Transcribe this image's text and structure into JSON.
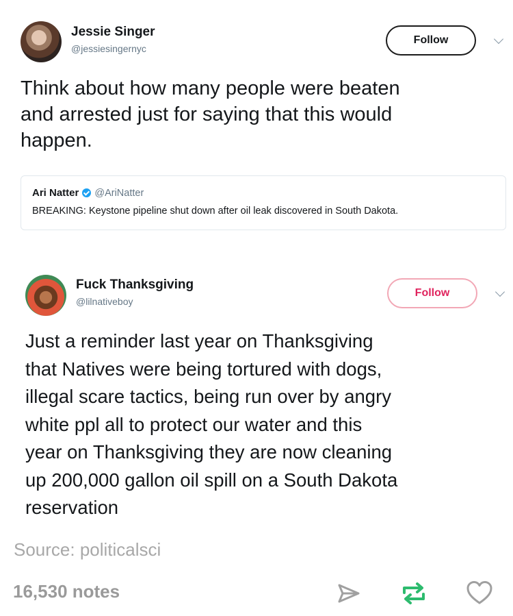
{
  "tweets": [
    {
      "user": {
        "name": "Jessie Singer",
        "handle": "@jessiesingernyc"
      },
      "follow_label": "Follow",
      "text_lines": [
        "Think about how many people were beaten",
        "and arrested just for saying that this would",
        "happen."
      ],
      "quote": {
        "name": "Ari Natter",
        "handle": "@AriNatter",
        "text": "BREAKING: Keystone pipeline shut down after oil leak discovered in South Dakota."
      }
    },
    {
      "user": {
        "name": "Fuck Thanksgiving",
        "handle": "@lilnativeboy"
      },
      "follow_label": "Follow",
      "text_lines": [
        "Just a reminder last year on Thanksgiving",
        "that Natives were being tortured with dogs,",
        "illegal scare tactics, being run over by angry",
        "white ppl all to protect our water and this",
        "year on Thanksgiving they are now cleaning",
        "up 200,000 gallon oil spill on a South Dakota",
        "reservation"
      ]
    }
  ],
  "post": {
    "source": "Source: politicalsci",
    "notes": "16,530 notes"
  },
  "icons": {
    "share": "paper-plane-icon",
    "reblog": "reblog-icon",
    "like": "heart-icon"
  },
  "colors": {
    "reblog_green": "#2dbb6e",
    "follow_pink": "#e0245e",
    "muted_gray": "#a8a8a8"
  }
}
